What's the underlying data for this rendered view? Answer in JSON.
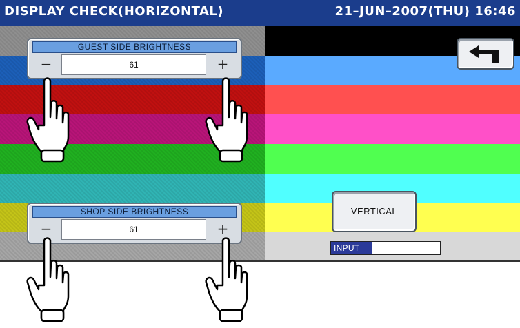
{
  "titlebar": {
    "title": "DISPLAY CHECK(HORIZONTAL)",
    "datetime": "21–JUN–2007(THU) 16:46"
  },
  "color_bands": {
    "left": [
      "#8f8f8f",
      "#1c5fb8",
      "#c01010",
      "#b81478",
      "#20b020",
      "#30b4b4",
      "#c4c418",
      "#a6a6a6"
    ],
    "right": [
      "#000000",
      "#5aaaff",
      "#ff5050",
      "#ff50c8",
      "#50ff50",
      "#50ffff",
      "#ffff50",
      "#d8d8d8"
    ]
  },
  "guest": {
    "header": "GUEST SIDE BRIGHTNESS",
    "minus": "−",
    "value": "61",
    "plus": "+"
  },
  "shop": {
    "header": "SHOP SIDE BRIGHTNESS",
    "minus": "−",
    "value": "61",
    "plus": "+"
  },
  "buttons": {
    "back_icon": "return-arrow-icon",
    "vertical_label": "VERTICAL"
  },
  "input_indicator": {
    "label": "INPUT",
    "fill_fraction": 0.38
  },
  "pointer_icon": "pointing-hand-icon"
}
